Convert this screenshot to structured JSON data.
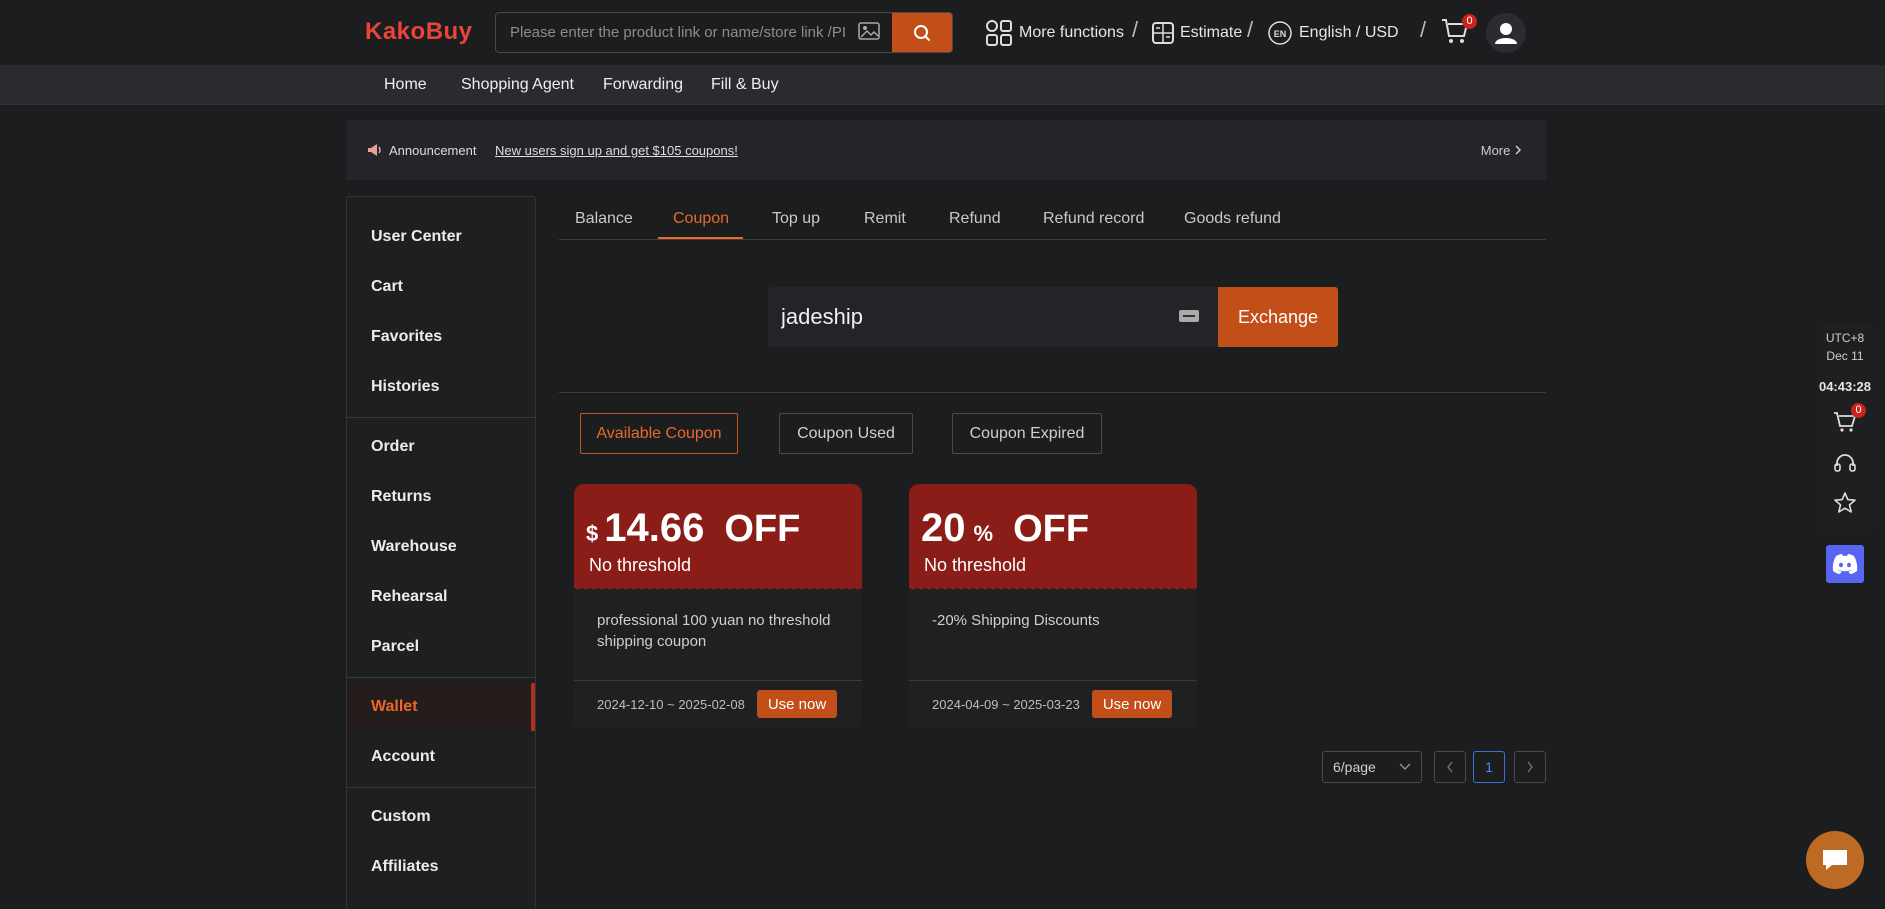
{
  "header": {
    "logo": "KakoBuy",
    "search_placeholder": "Please enter the product link or name/store link /PI",
    "more_functions": "More functions",
    "estimate": "Estimate",
    "lang_currency": "English / USD",
    "lang_badge": "EN",
    "cart_count": "0"
  },
  "menu": [
    "Home",
    "Shopping Agent",
    "Forwarding",
    "Fill & Buy"
  ],
  "announcement": {
    "label": "Announcement",
    "link": "New users sign up and get $105 coupons!",
    "more": "More"
  },
  "sidebar": {
    "items": [
      "User Center",
      "Cart",
      "Favorites",
      "Histories",
      "Order",
      "Returns",
      "Warehouse",
      "Rehearsal",
      "Parcel",
      "Wallet",
      "Account",
      "Custom",
      "Affiliates"
    ],
    "active": "Wallet"
  },
  "tabs": [
    "Balance",
    "Coupon",
    "Top up",
    "Remit",
    "Refund",
    "Refund record",
    "Goods refund"
  ],
  "active_tab": "Coupon",
  "exchange": {
    "code_value": "jadeship",
    "button": "Exchange"
  },
  "filters": [
    "Available Coupon",
    "Coupon Used",
    "Coupon Expired"
  ],
  "active_filter": "Available Coupon",
  "coupons": [
    {
      "symbol": "$",
      "value": "14.66",
      "suffix": "",
      "off": "OFF",
      "threshold": "No threshold",
      "description": "professional 100 yuan no threshold shipping coupon",
      "date_range": "2024-12-10 ~ 2025-02-08",
      "button": "Use now"
    },
    {
      "symbol": "",
      "value": "20",
      "suffix": "%",
      "off": "OFF",
      "threshold": "No threshold",
      "description": "-20% Shipping Discounts",
      "date_range": "2024-04-09 ~ 2025-03-23",
      "button": "Use now"
    }
  ],
  "pagination": {
    "page_size": "6/page",
    "current_page": "1"
  },
  "right_toolbar": {
    "timezone": "UTC+8",
    "date": "Dec 11",
    "time": "04:43:28",
    "cart_count": "0"
  },
  "colors": {
    "accent": "#c24e18",
    "accent_text": "#e8692a",
    "coupon_red": "#8b1d18",
    "background": "#1c1d1f"
  }
}
